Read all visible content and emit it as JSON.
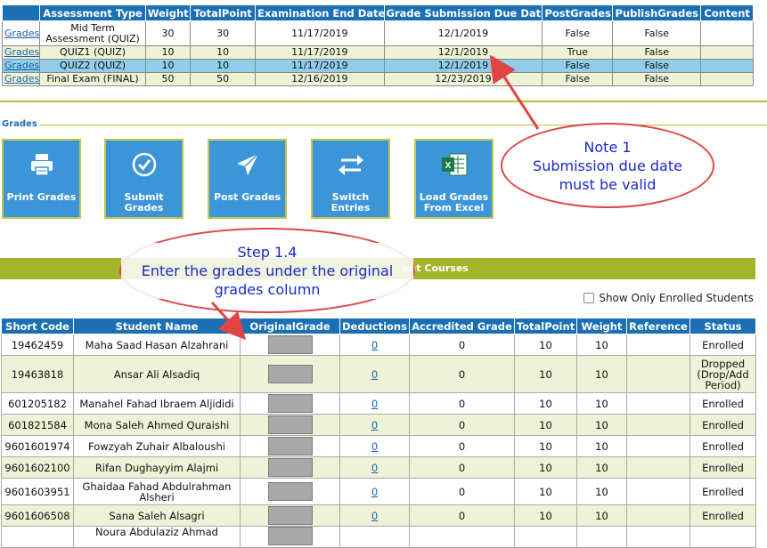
{
  "assessments": {
    "headers": [
      "",
      "Assessment Type",
      "Weight",
      "TotalPoint",
      "Examination End Date",
      "Grade Submission Due Date",
      "PostGrades",
      "PublishGrades",
      "Content"
    ],
    "rows": [
      {
        "link": "Grades",
        "type_line1": "Mid Term",
        "type_line2": "Assessment (QUIZ)",
        "weight": "30",
        "total": "30",
        "exam_end": "11/17/2019",
        "due": "12/1/2019",
        "post": "False",
        "publish": "False",
        "content": ""
      },
      {
        "link": "Grades",
        "type_line1": "QUIZ1 (QUIZ)",
        "type_line2": "",
        "weight": "10",
        "total": "10",
        "exam_end": "11/17/2019",
        "due": "12/1/2019",
        "post": "True",
        "publish": "False",
        "content": ""
      },
      {
        "link": "Grades",
        "type_line1": "QUIZ2 (QUIZ)",
        "type_line2": "",
        "weight": "10",
        "total": "10",
        "exam_end": "11/17/2019",
        "due": "12/1/2019",
        "post": "False",
        "publish": "False",
        "content": ""
      },
      {
        "link": "Grades",
        "type_line1": "Final Exam (FINAL)",
        "type_line2": "",
        "weight": "50",
        "total": "50",
        "exam_end": "12/16/2019",
        "due": "12/23/2019",
        "post": "False",
        "publish": "False",
        "content": ""
      }
    ]
  },
  "grades_section": {
    "legend": "Grades",
    "buttons": [
      {
        "line1": "Print Grades",
        "line2": "",
        "icon": "printer-icon"
      },
      {
        "line1": "Submit Grades",
        "line2": "",
        "icon": "check-circle-icon"
      },
      {
        "line1": "Post Grades",
        "line2": "",
        "icon": "paper-plane-icon"
      },
      {
        "line1": "Switch Entries",
        "line2": "",
        "icon": "swap-arrows-icon"
      },
      {
        "line1": "Load Grades",
        "line2": "From Excel",
        "icon": "excel-icon"
      }
    ]
  },
  "band": {
    "text": "ent Courses"
  },
  "show_only_enrolled": {
    "label": "Show Only Enrolled Students",
    "checked": false
  },
  "students": {
    "headers": [
      "Short Code",
      "Student Name",
      "OriginalGrade",
      "Deductions",
      "Accredited Grade",
      "TotalPoint",
      "Weight",
      "Reference",
      "Status"
    ],
    "rows": [
      {
        "code": "19462459",
        "name1": "Maha Saad Hasan Alzahrani",
        "name2": "",
        "deduction": "0",
        "accredited": "0",
        "total": "10",
        "weight": "10",
        "reference": "",
        "status1": "Enrolled",
        "status2": "",
        "status3": ""
      },
      {
        "code": "19463818",
        "name1": "Ansar Ali Alsadiq",
        "name2": "",
        "deduction": "0",
        "accredited": "0",
        "total": "10",
        "weight": "10",
        "reference": "",
        "status1": "Dropped",
        "status2": "(Drop/Add",
        "status3": "Period)"
      },
      {
        "code": "601205182",
        "name1": "Manahel Fahad Ibraem Aljididi",
        "name2": "",
        "deduction": "0",
        "accredited": "0",
        "total": "10",
        "weight": "10",
        "reference": "",
        "status1": "Enrolled",
        "status2": "",
        "status3": ""
      },
      {
        "code": "601821584",
        "name1": "Mona Saleh Ahmed Quraishi",
        "name2": "",
        "deduction": "0",
        "accredited": "0",
        "total": "10",
        "weight": "10",
        "reference": "",
        "status1": "Enrolled",
        "status2": "",
        "status3": ""
      },
      {
        "code": "9601601974",
        "name1": "Fowzyah Zuhair Albaloushi",
        "name2": "",
        "deduction": "0",
        "accredited": "0",
        "total": "10",
        "weight": "10",
        "reference": "",
        "status1": "Enrolled",
        "status2": "",
        "status3": ""
      },
      {
        "code": "9601602100",
        "name1": "Rifan Dughayyim Alajmi",
        "name2": "",
        "deduction": "0",
        "accredited": "0",
        "total": "10",
        "weight": "10",
        "reference": "",
        "status1": "Enrolled",
        "status2": "",
        "status3": ""
      },
      {
        "code": "9601603951",
        "name1": "Ghaidaa Fahad Abdulrahman",
        "name2": "Alsheri",
        "deduction": "0",
        "accredited": "0",
        "total": "10",
        "weight": "10",
        "reference": "",
        "status1": "Enrolled",
        "status2": "",
        "status3": ""
      },
      {
        "code": "9601606508",
        "name1": "Sana Saleh Alsagri",
        "name2": "",
        "deduction": "0",
        "accredited": "0",
        "total": "10",
        "weight": "10",
        "reference": "",
        "status1": "Enrolled",
        "status2": "",
        "status3": ""
      },
      {
        "code": "",
        "name1": "Noura Abdulaziz Ahmad",
        "name2": "",
        "deduction": "",
        "accredited": "",
        "total": "",
        "weight": "",
        "reference": "",
        "status1": "",
        "status2": "",
        "status3": ""
      }
    ]
  },
  "annotations": {
    "note": {
      "line1": "Note 1",
      "line2": "Submission due date",
      "line3": "must be valid"
    },
    "step": {
      "line1": "Step 1.4",
      "line2": "Enter the grades under the original",
      "line3": "grades column"
    }
  },
  "colors": {
    "header_blue": "#1a6fb5",
    "button_blue": "#3b95d8",
    "band_green": "#a3b52a",
    "annotation_red": "#e04545",
    "annotation_text": "#1e28c8"
  }
}
